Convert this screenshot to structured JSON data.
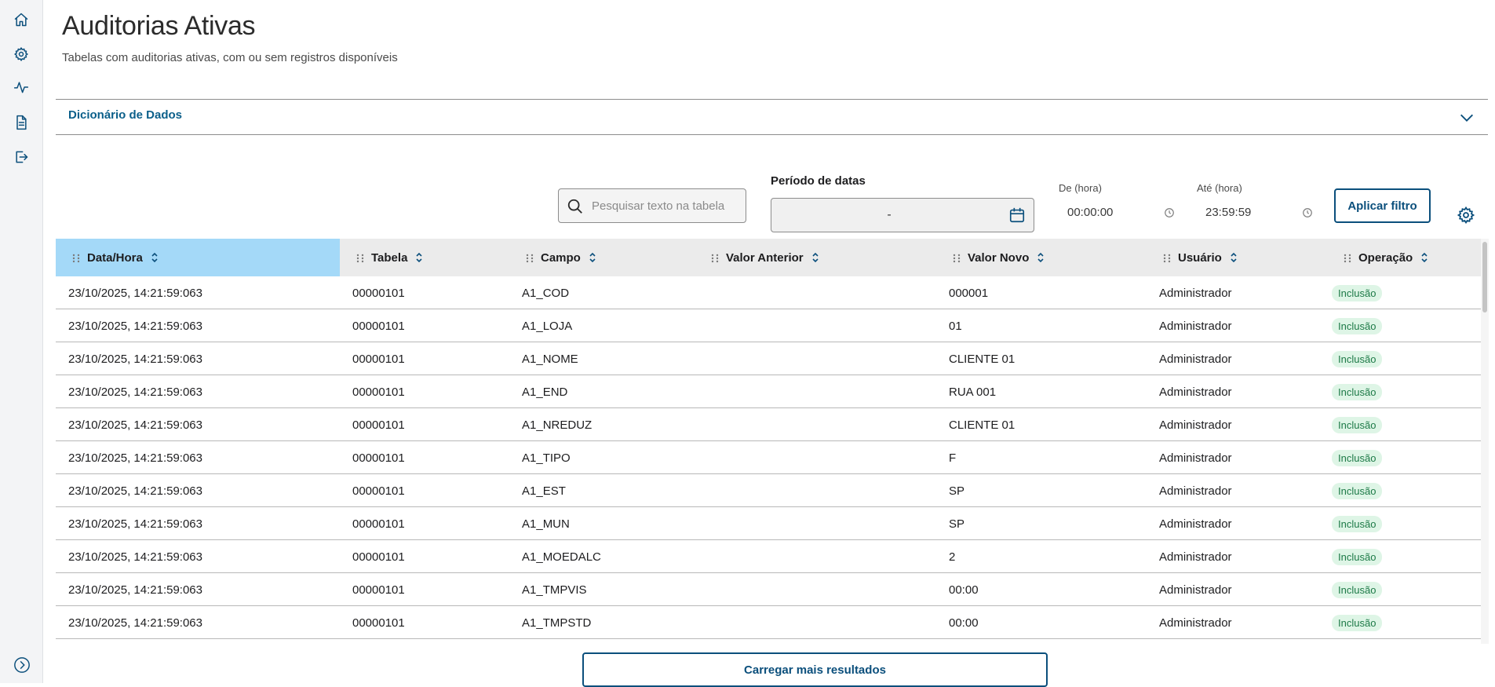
{
  "page": {
    "title": "Auditorias Ativas",
    "subtitle": "Tabelas com auditorias ativas, com ou sem registros disponíveis"
  },
  "sidebar": {
    "items": [
      {
        "icon": "home-icon"
      },
      {
        "icon": "gear-icon"
      },
      {
        "icon": "activity-icon"
      },
      {
        "icon": "document-icon"
      },
      {
        "icon": "logout-icon"
      }
    ],
    "expand_icon": "chevron-right-circle-icon"
  },
  "accordion": {
    "label": "Dicionário de Dados"
  },
  "filters": {
    "search_placeholder": "Pesquisar texto na tabela",
    "period_label": "Período de datas",
    "period_value": "-",
    "from_label": "De (hora)",
    "from_value": "00:00:00",
    "to_label": "Até (hora)",
    "to_value": "23:59:59",
    "apply_label": "Aplicar filtro"
  },
  "table": {
    "columns": [
      "Data/Hora",
      "Tabela",
      "Campo",
      "Valor Anterior",
      "Valor Novo",
      "Usuário",
      "Operação"
    ],
    "sorted_column": "Data/Hora",
    "rows": [
      [
        "23/10/2025, 14:21:59:063",
        "00000101",
        "A1_COD",
        "",
        "000001",
        "Administrador",
        "Inclusão"
      ],
      [
        "23/10/2025, 14:21:59:063",
        "00000101",
        "A1_LOJA",
        "",
        "01",
        "Administrador",
        "Inclusão"
      ],
      [
        "23/10/2025, 14:21:59:063",
        "00000101",
        "A1_NOME",
        "",
        "CLIENTE 01",
        "Administrador",
        "Inclusão"
      ],
      [
        "23/10/2025, 14:21:59:063",
        "00000101",
        "A1_END",
        "",
        "RUA 001",
        "Administrador",
        "Inclusão"
      ],
      [
        "23/10/2025, 14:21:59:063",
        "00000101",
        "A1_NREDUZ",
        "",
        "CLIENTE 01",
        "Administrador",
        "Inclusão"
      ],
      [
        "23/10/2025, 14:21:59:063",
        "00000101",
        "A1_TIPO",
        "",
        "F",
        "Administrador",
        "Inclusão"
      ],
      [
        "23/10/2025, 14:21:59:063",
        "00000101",
        "A1_EST",
        "",
        "SP",
        "Administrador",
        "Inclusão"
      ],
      [
        "23/10/2025, 14:21:59:063",
        "00000101",
        "A1_MUN",
        "",
        "SP",
        "Administrador",
        "Inclusão"
      ],
      [
        "23/10/2025, 14:21:59:063",
        "00000101",
        "A1_MOEDALC",
        "",
        "2",
        "Administrador",
        "Inclusão"
      ],
      [
        "23/10/2025, 14:21:59:063",
        "00000101",
        "A1_TMPVIS",
        "",
        "00:00",
        "Administrador",
        "Inclusão"
      ],
      [
        "23/10/2025, 14:21:59:063",
        "00000101",
        "A1_TMPSTD",
        "",
        "00:00",
        "Administrador",
        "Inclusão"
      ]
    ]
  },
  "load_more_label": "Carregar mais resultados",
  "colors": {
    "primary": "#0b4f7c",
    "active_header": "#a4d9f8",
    "badge_bg": "#def5e6",
    "badge_text": "#1d7a47"
  }
}
